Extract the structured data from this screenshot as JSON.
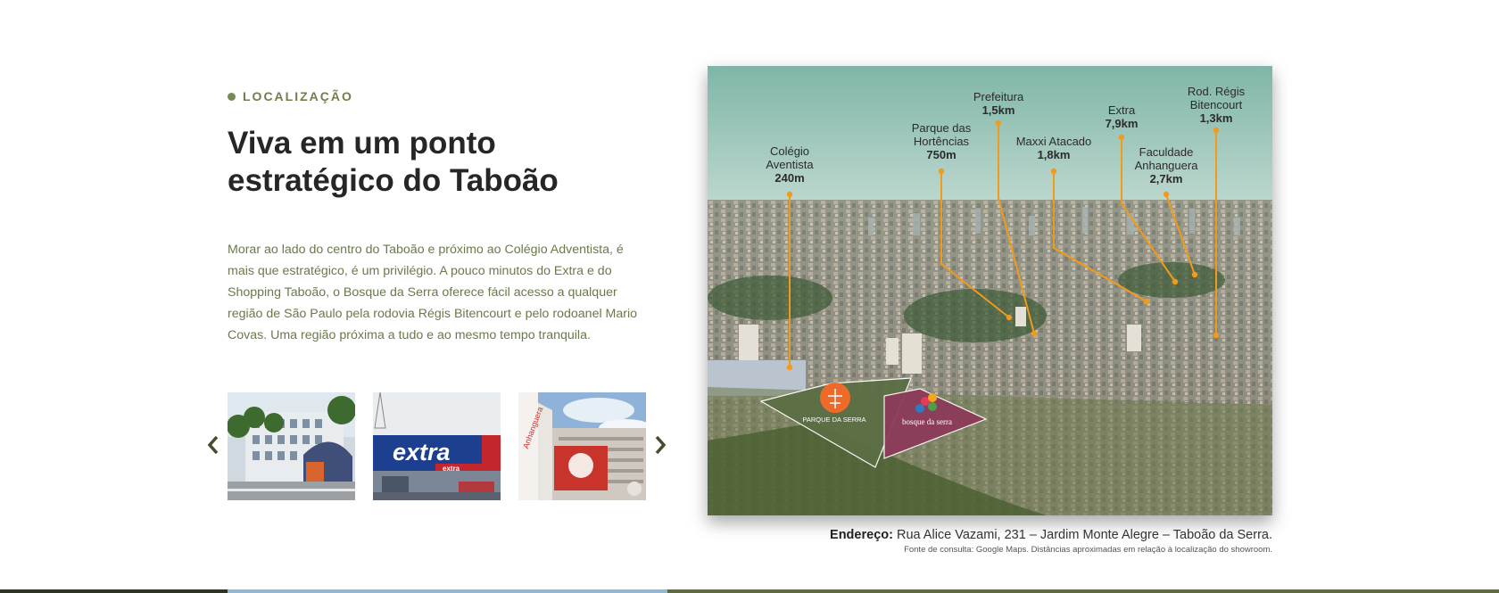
{
  "section": {
    "eyebrow": "LOCALIZAÇÃO",
    "title_line1": "Viva em um ponto",
    "title_line2": "estratégico do Taboão",
    "description": "Morar ao lado do centro do Taboão e próximo ao Colégio Adventista, é mais que estratégico, é um privilégio. A pouco minutos do Extra e do Shopping Taboão, o Bosque da Serra oferece fácil acesso a qualquer região de São Paulo pela rodovia Régis Bitencourt e pelo rodoanel Mario Covas. Uma região próxima a tudo e ao mesmo tempo tranquila."
  },
  "carousel": {
    "prev_icon": "chevron-left-icon",
    "next_icon": "chevron-right-icon",
    "thumbs": [
      {
        "name": "colegio-adventista-photo"
      },
      {
        "name": "extra-store-photo",
        "sign": "extra",
        "subsign": "extra"
      },
      {
        "name": "anhanguera-building-photo",
        "sign": "Anhanguera"
      }
    ]
  },
  "map": {
    "labels": [
      {
        "name": "Colégio",
        "name2": "Aventista",
        "dist": "240m"
      },
      {
        "name": "Parque das",
        "name2": "Hortências",
        "dist": "750m"
      },
      {
        "name": "Prefeitura",
        "name2": "",
        "dist": "1,5km"
      },
      {
        "name": "Maxxi Atacado",
        "name2": "",
        "dist": "1,8km"
      },
      {
        "name": "Extra",
        "name2": "",
        "dist": "7,9km"
      },
      {
        "name": "Faculdade",
        "name2": "Anhanguera",
        "dist": "2,7km"
      },
      {
        "name": "Rod. Régis",
        "name2": "Bitencourt",
        "dist": "1,3km"
      }
    ],
    "logo_parque": "PARQUE DA SERRA",
    "logo_bosque": "bosque da serra",
    "colors": {
      "line": "#f29a1a",
      "parque": "#5b6e44",
      "bosque": "#8c3b5a",
      "logo_orange": "#ee6a2b"
    }
  },
  "address": {
    "label": "Endereço:",
    "value": " Rua Alice Vazami, 231 – Jardim Monte Alegre – Taboão da Serra.",
    "source": "Fonte de consulta: Google Maps. Distâncias aproximadas em relação à localização do showroom."
  },
  "colors": {
    "accent": "#6f7f49",
    "title": "#262626"
  }
}
